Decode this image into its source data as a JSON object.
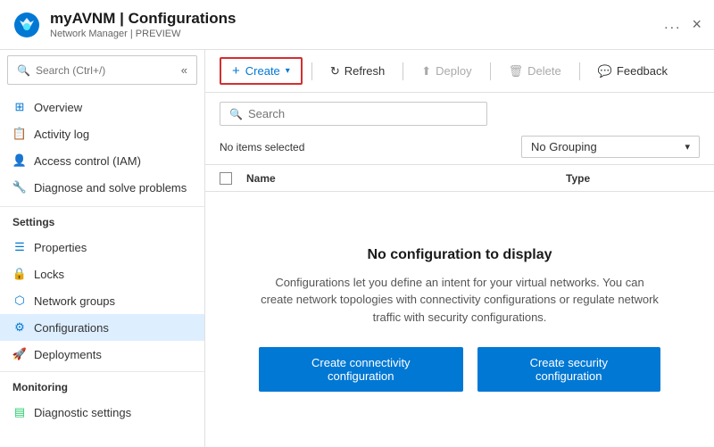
{
  "header": {
    "title": "myAVNM | Configurations",
    "subtitle": "Network Manager | PREVIEW",
    "dots_label": "...",
    "close_label": "×"
  },
  "sidebar": {
    "search_placeholder": "Search (Ctrl+/)",
    "collapse_icon": "«",
    "items_top": [
      {
        "id": "overview",
        "label": "Overview",
        "icon": "overview"
      },
      {
        "id": "activity-log",
        "label": "Activity log",
        "icon": "activity"
      },
      {
        "id": "access-control",
        "label": "Access control (IAM)",
        "icon": "access"
      },
      {
        "id": "diagnose",
        "label": "Diagnose and solve problems",
        "icon": "diagnose"
      }
    ],
    "section_settings": "Settings",
    "items_settings": [
      {
        "id": "properties",
        "label": "Properties",
        "icon": "properties"
      },
      {
        "id": "locks",
        "label": "Locks",
        "icon": "locks"
      },
      {
        "id": "network-groups",
        "label": "Network groups",
        "icon": "network"
      },
      {
        "id": "configurations",
        "label": "Configurations",
        "icon": "configurations",
        "active": true
      },
      {
        "id": "deployments",
        "label": "Deployments",
        "icon": "deployments"
      }
    ],
    "section_monitoring": "Monitoring",
    "items_monitoring": [
      {
        "id": "diagnostic-settings",
        "label": "Diagnostic settings",
        "icon": "diagnostic"
      }
    ]
  },
  "toolbar": {
    "create_label": "Create",
    "refresh_label": "Refresh",
    "deploy_label": "Deploy",
    "delete_label": "Delete",
    "feedback_label": "Feedback"
  },
  "content": {
    "search_placeholder": "Search",
    "filter_text": "No items selected",
    "grouping_label": "No Grouping",
    "col_name": "Name",
    "col_type": "Type",
    "empty_title": "No configuration to display",
    "empty_desc": "Configurations let you define an intent for your virtual networks. You can create network topologies with connectivity configurations or regulate network traffic with security configurations.",
    "btn_connectivity": "Create connectivity configuration",
    "btn_security": "Create security configuration"
  }
}
